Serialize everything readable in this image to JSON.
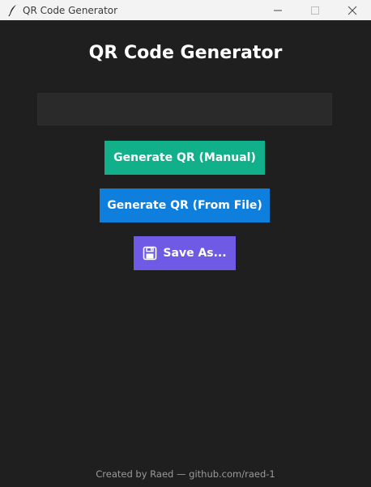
{
  "window": {
    "title": "QR Code Generator"
  },
  "header": {
    "title": "QR Code Generator"
  },
  "input": {
    "value": "",
    "placeholder": ""
  },
  "buttons": {
    "manual_label": "Generate QR (Manual)",
    "file_label": "Generate QR (From File)",
    "save_label": "Save As..."
  },
  "footer": {
    "text": "Created by Raed — github.com/raed-1"
  },
  "colors": {
    "background": "#1f1f1f",
    "manual_button": "#12b08a",
    "file_button": "#0f7fde",
    "save_button": "#6f5ae6"
  },
  "icons": {
    "app": "feather-icon",
    "save": "floppy-disk-icon"
  }
}
